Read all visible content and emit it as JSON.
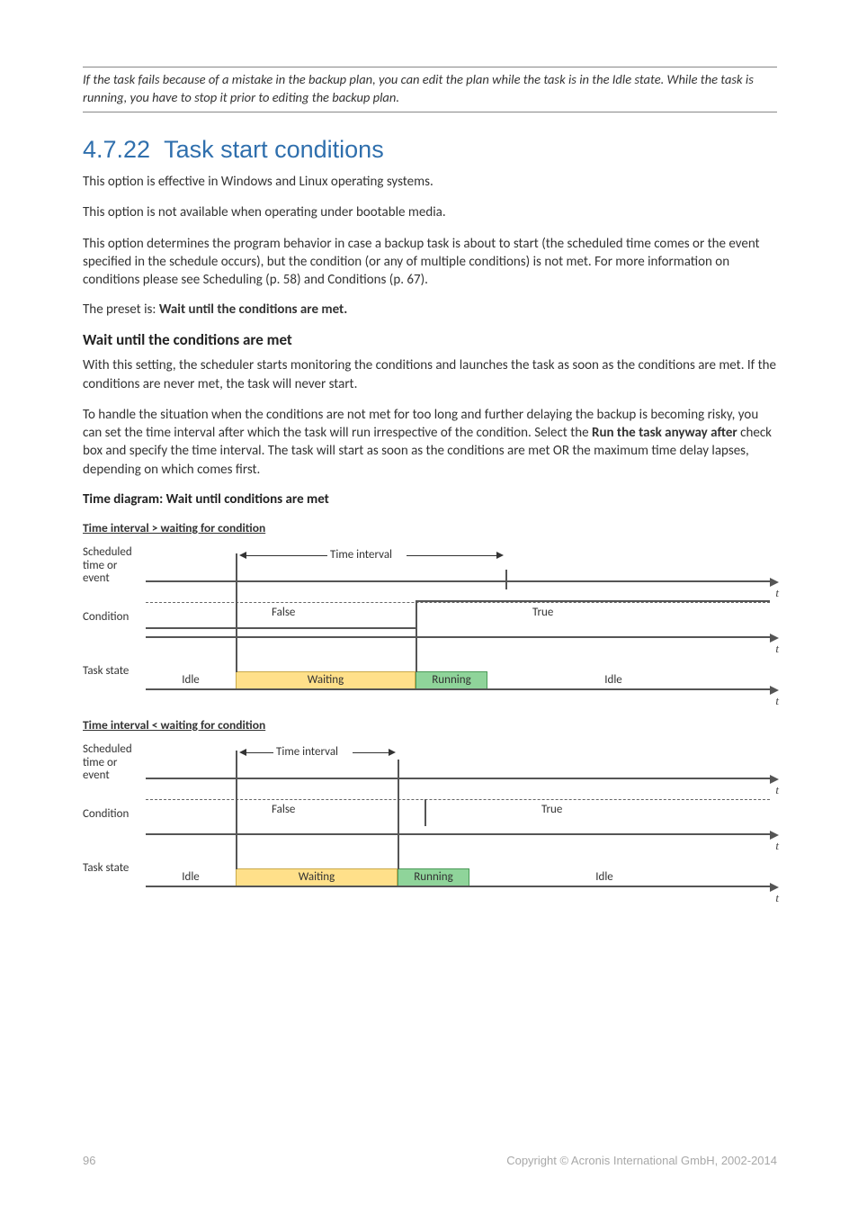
{
  "note": "If the task fails because of a mistake in the backup plan, you can edit the plan while the task is in the Idle state. While the task is running, you have to stop it prior to editing the backup plan.",
  "heading": {
    "number": "4.7.22",
    "title": "Task start conditions"
  },
  "paragraphs": {
    "p1": "This option is effective in Windows and Linux operating systems.",
    "p2": "This option is not available when operating under bootable media.",
    "p3": "This option determines the program behavior in case a backup task is about to start (the scheduled time comes or the event specified in the schedule occurs), but the condition (or any of multiple conditions) is not met. For more information on conditions please see Scheduling (p. 58) and Conditions (p. 67).",
    "preset_label": "The preset is: ",
    "preset_value": "Wait until the conditions are met.",
    "sub1_title": "Wait until the conditions are met",
    "p4": "With this setting, the scheduler starts monitoring the conditions and launches the task as soon as the conditions are met. If the conditions are never met, the task will never start.",
    "p5_a": "To handle the situation when the conditions are not met for too long and further delaying the backup is becoming risky, you can set the time interval after which the task will run irrespective of the condition. Select the ",
    "p5_bold": "Run the task anyway after",
    "p5_b": " check box and specify the time interval. The task will start as soon as the conditions are met OR the maximum time delay lapses, depending on which comes first.",
    "diagram_title": "Time diagram: Wait until conditions are met",
    "diag1_title": "Time interval > waiting for condition",
    "diag2_title": "Time interval < waiting for condition"
  },
  "labels": {
    "scheduled": "Scheduled time or event",
    "condition": "Condition",
    "task_state": "Task state",
    "time_interval": "Time interval",
    "false": "False",
    "true": "True",
    "idle": "Idle",
    "waiting": "Waiting",
    "running": "Running",
    "t": "t"
  },
  "chart_data": [
    {
      "title": "Time interval > waiting for condition",
      "rows": [
        {
          "name": "Scheduled time or event",
          "interval": {
            "start": 100,
            "end": 400,
            "label": "Time interval"
          }
        },
        {
          "name": "Condition",
          "segments": [
            {
              "label": "False",
              "start": 0,
              "end": 300
            },
            {
              "label": "True",
              "start": 300,
              "end": 700
            }
          ]
        },
        {
          "name": "Task state",
          "segments": [
            {
              "label": "Idle",
              "start": 0,
              "end": 100,
              "color": "none"
            },
            {
              "label": "Waiting",
              "start": 100,
              "end": 300,
              "color": "#ffe08a"
            },
            {
              "label": "Running",
              "start": 300,
              "end": 380,
              "color": "#8fd49a"
            },
            {
              "label": "Idle",
              "start": 380,
              "end": 700,
              "color": "none"
            }
          ]
        }
      ]
    },
    {
      "title": "Time interval < waiting for condition",
      "rows": [
        {
          "name": "Scheduled time or event",
          "interval": {
            "start": 100,
            "end": 280,
            "label": "Time interval"
          }
        },
        {
          "name": "Condition",
          "segments": [
            {
              "label": "False",
              "start": 0,
              "end": 310
            },
            {
              "label": "True",
              "start": 310,
              "end": 700
            }
          ]
        },
        {
          "name": "Task state",
          "segments": [
            {
              "label": "Idle",
              "start": 0,
              "end": 100,
              "color": "none"
            },
            {
              "label": "Waiting",
              "start": 100,
              "end": 280,
              "color": "#ffe08a"
            },
            {
              "label": "Running",
              "start": 280,
              "end": 360,
              "color": "#8fd49a"
            },
            {
              "label": "Idle",
              "start": 360,
              "end": 700,
              "color": "none"
            }
          ]
        }
      ]
    }
  ],
  "footer": {
    "page": "96",
    "copyright": "Copyright © Acronis International GmbH, 2002-2014"
  }
}
